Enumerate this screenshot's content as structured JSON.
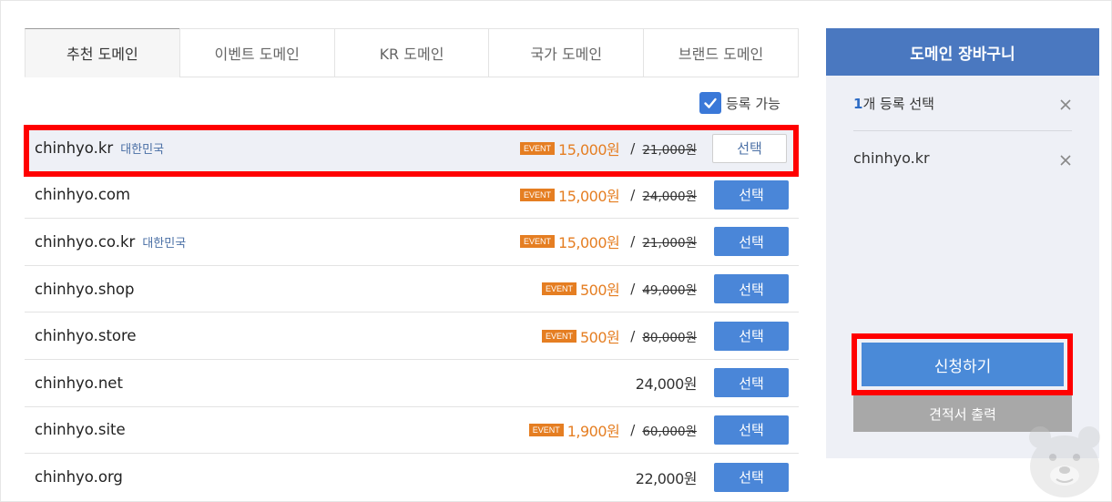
{
  "tabs": [
    {
      "label": "추천 도메인",
      "active": true
    },
    {
      "label": "이벤트 도메인",
      "active": false
    },
    {
      "label": "KR 도메인",
      "active": false
    },
    {
      "label": "국가 도메인",
      "active": false
    },
    {
      "label": "브랜드 도메인",
      "active": false
    }
  ],
  "filter": {
    "label": "등록 가능",
    "checked": true
  },
  "event_badge": "EVENT",
  "slash": "/",
  "domains": [
    {
      "name": "chinhyo.kr",
      "country": "대한민국",
      "event": true,
      "price": "15,000원",
      "original": "21,000원",
      "button": "선택",
      "selected": true
    },
    {
      "name": "chinhyo.com",
      "country": "",
      "event": true,
      "price": "15,000원",
      "original": "24,000원",
      "button": "선택",
      "selected": false
    },
    {
      "name": "chinhyo.co.kr",
      "country": "대한민국",
      "event": true,
      "price": "15,000원",
      "original": "21,000원",
      "button": "선택",
      "selected": false
    },
    {
      "name": "chinhyo.shop",
      "country": "",
      "event": true,
      "price": "500원",
      "original": "49,000원",
      "button": "선택",
      "selected": false
    },
    {
      "name": "chinhyo.store",
      "country": "",
      "event": true,
      "price": "500원",
      "original": "80,000원",
      "button": "선택",
      "selected": false
    },
    {
      "name": "chinhyo.net",
      "country": "",
      "event": false,
      "price": "24,000원",
      "original": "",
      "button": "선택",
      "selected": false
    },
    {
      "name": "chinhyo.site",
      "country": "",
      "event": true,
      "price": "1,900원",
      "original": "60,000원",
      "button": "선택",
      "selected": false
    },
    {
      "name": "chinhyo.org",
      "country": "",
      "event": false,
      "price": "22,000원",
      "original": "",
      "button": "선택",
      "selected": false
    }
  ],
  "cart": {
    "title": "도메인 장바구니",
    "count_num": "1",
    "count_text": "개 등록 선택",
    "items": [
      "chinhyo.kr"
    ],
    "apply_label": "신청하기",
    "quote_label": "견적서 출력"
  },
  "colors": {
    "accent": "#4a86d8",
    "event": "#e57e22",
    "highlight": "#ff0000",
    "cart_header": "#4a78c0"
  }
}
